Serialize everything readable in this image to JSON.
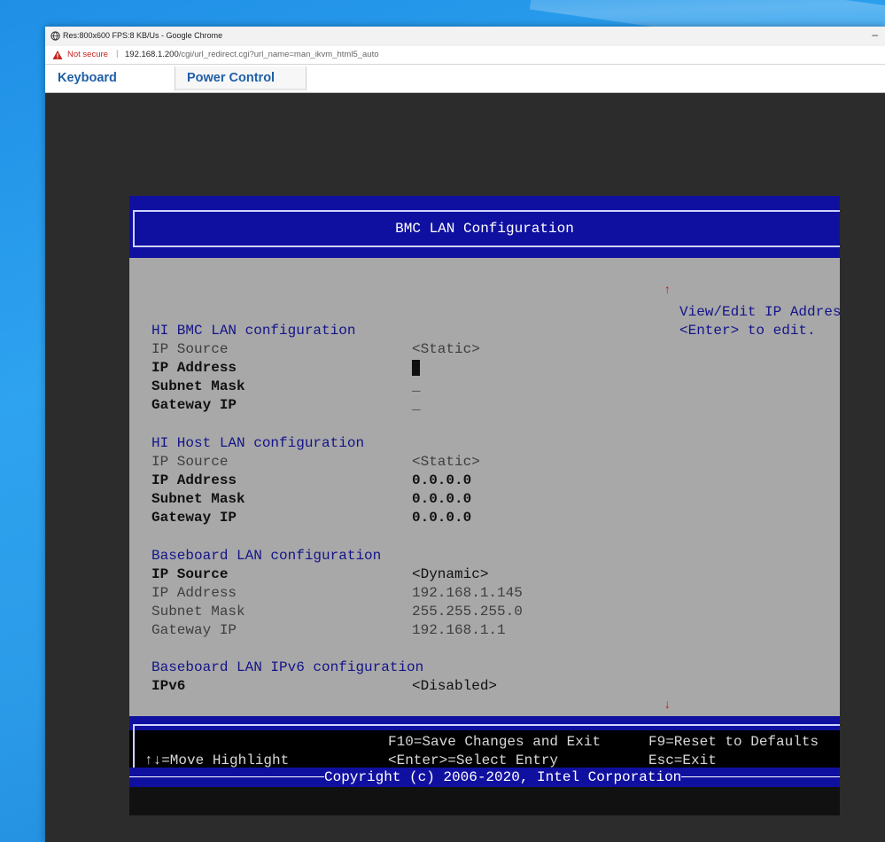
{
  "browser": {
    "window_title": "Res:800x600 FPS:8 KB/Us - Google Chrome",
    "security_label": "Not secure",
    "url_host": "192.168.1.200",
    "url_path": "/cgi/url_redirect.cgi?url_name=man_ikvm_html5_auto",
    "minimize_glyph": "–"
  },
  "kvm_menu": {
    "tabs": [
      {
        "label": "Keyboard"
      },
      {
        "label": "Power Control"
      }
    ]
  },
  "bios": {
    "title": "BMC LAN Configuration",
    "scroll_up": "↑",
    "scroll_down": "↓",
    "help": {
      "line1": "View/Edit IP Address",
      "line2": "<Enter> to edit."
    },
    "sections": [
      {
        "heading": "HI BMC LAN configuration",
        "rows": [
          {
            "label": "IP Source",
            "value": "<Static>"
          },
          {
            "label": "IP Address",
            "value": ""
          },
          {
            "label": "Subnet Mask",
            "value": "_"
          },
          {
            "label": "Gateway IP",
            "value": "_"
          }
        ]
      },
      {
        "heading": "HI Host LAN configuration",
        "rows": [
          {
            "label": "IP Source",
            "value": "<Static>"
          },
          {
            "label": "IP Address",
            "value": "0.0.0.0"
          },
          {
            "label": "Subnet Mask",
            "value": "0.0.0.0"
          },
          {
            "label": "Gateway IP",
            "value": "0.0.0.0"
          }
        ]
      },
      {
        "heading": "Baseboard LAN configuration",
        "rows": [
          {
            "label": "IP Source",
            "value": "<Dynamic>"
          },
          {
            "label": "IP Address",
            "value": "192.168.1.145"
          },
          {
            "label": "Subnet Mask",
            "value": "255.255.255.0"
          },
          {
            "label": "Gateway IP",
            "value": "192.168.1.1"
          }
        ]
      },
      {
        "heading": "Baseboard LAN IPv6 configuration",
        "rows": [
          {
            "label": "IPv6",
            "value": "<Disabled>"
          }
        ]
      }
    ],
    "footer": {
      "move": "↑↓=Move Highlight",
      "save": "F10=Save Changes and Exit",
      "select": "<Enter>=Select Entry",
      "reset": "F9=Reset to Defaults",
      "exit": "Esc=Exit",
      "copyright": "Copyright (c) 2006-2020, Intel Corporation"
    }
  }
}
